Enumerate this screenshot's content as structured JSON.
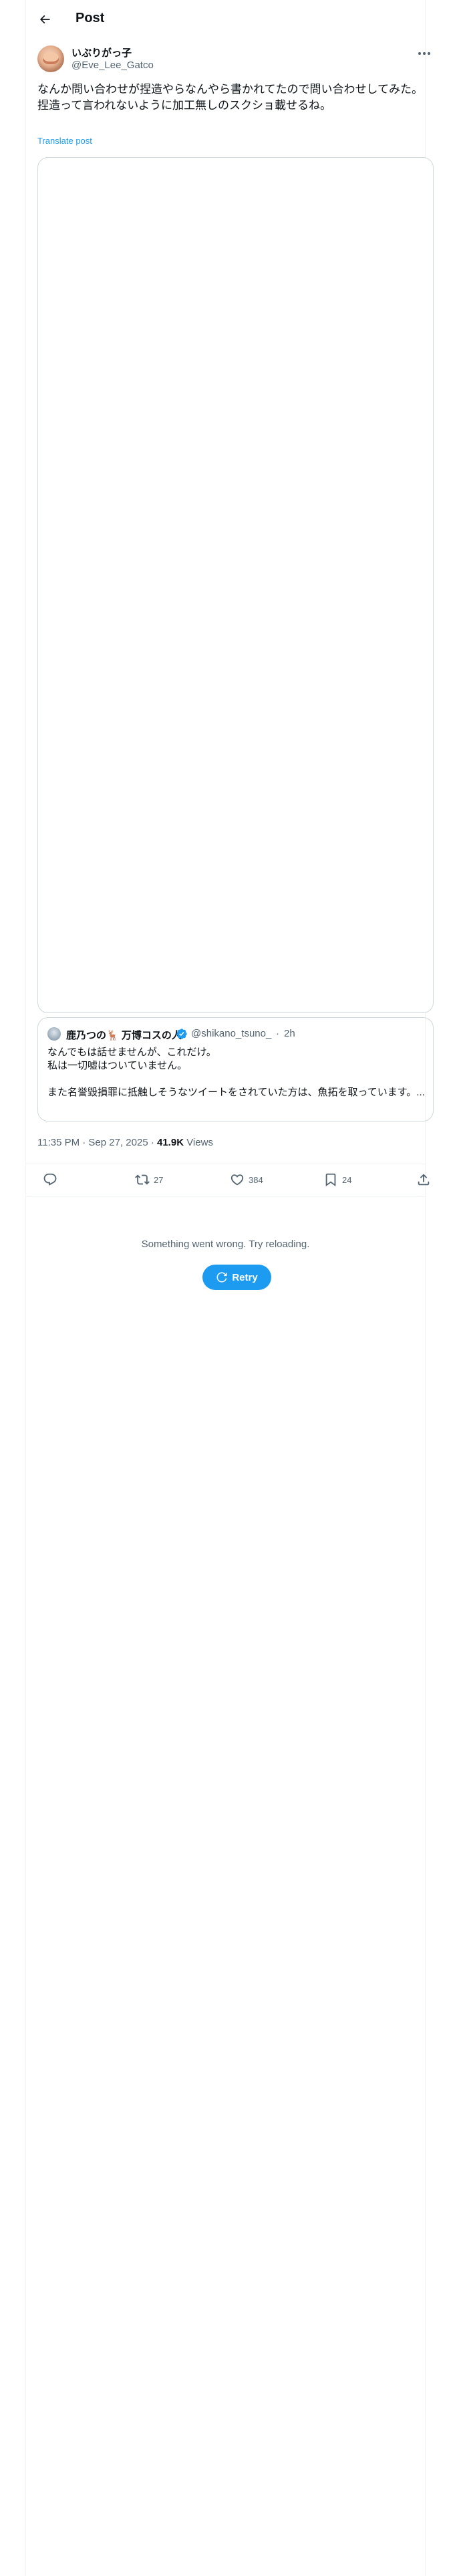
{
  "header": {
    "title": "Post",
    "back_icon": "arrow-left-icon"
  },
  "author": {
    "display_name": "いぶりがっ子",
    "handle": "@Eve_Lee_Gatco"
  },
  "tweet": {
    "text": "なんか問い合わせが捏造やらなんやら書かれてたので問い合わせしてみた。\n捏造って言われないように加工無しのスクショ載せるね。",
    "translate_label": "Translate post"
  },
  "quote": {
    "display_name": "鹿乃つの🦌 万博コスの人",
    "handle": "@shikano_tsuno_",
    "separator": "·",
    "time": "2h",
    "text": "なんでもは話せませんが、これだけ。\n私は一切嘘はついていません。\n\nまた名誉毀損罪に抵触しそうなツイートをされていた方は、魚拓を取っています。..."
  },
  "meta": {
    "timestamp": "11:35 PM · Sep 27, 2025 · ",
    "views_count": "41.9K",
    "views_label": " Views"
  },
  "actions": {
    "reply_icon": "reply-icon",
    "repost_count": "27",
    "like_count": "384",
    "bookmark_count": "24",
    "share_icon": "share-icon"
  },
  "error": {
    "message": "Something went wrong. Try reloading.",
    "retry_label": "Retry"
  },
  "colors": {
    "accent": "#1d9bf0",
    "text_primary": "#0f1419",
    "text_secondary": "#536471",
    "border": "#cfd9de"
  }
}
